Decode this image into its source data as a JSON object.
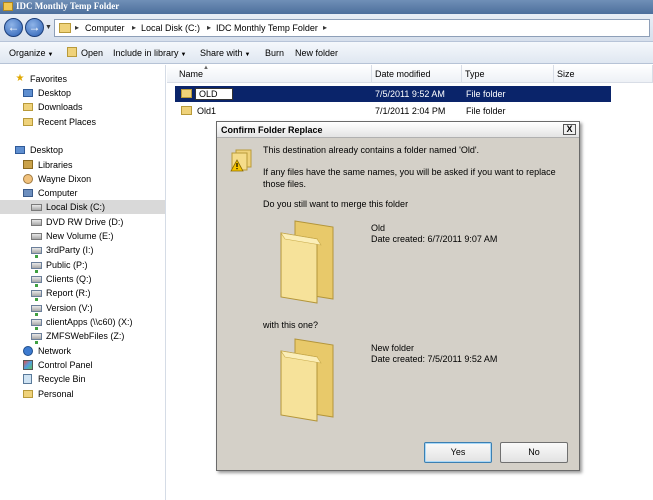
{
  "window": {
    "title": "IDC Monthly Temp Folder"
  },
  "address": {
    "crumbs": [
      "Computer",
      "Local Disk (C:)",
      "IDC Monthly Temp Folder"
    ]
  },
  "toolbar": {
    "organize": "Organize",
    "open": "Open",
    "include_in_library": "Include in library",
    "share_with": "Share with",
    "burn": "Burn",
    "new_folder": "New folder"
  },
  "nav": {
    "favorites": "Favorites",
    "desktop": "Desktop",
    "downloads": "Downloads",
    "recent_places": "Recent Places",
    "desktop_root": "Desktop",
    "libraries": "Libraries",
    "user": "Wayne Dixon",
    "computer": "Computer",
    "drives": [
      "Local Disk (C:)",
      "DVD RW Drive (D:)",
      "New Volume (E:)",
      "3rdParty (I:)",
      "Public (P:)",
      "Clients (Q:)",
      "Report (R:)",
      "Version (V:)",
      "clientApps (\\\\c60) (X:)",
      "ZMFSWebFiles (Z:)"
    ],
    "network": "Network",
    "control_panel": "Control Panel",
    "recycle_bin": "Recycle Bin",
    "personal": "Personal"
  },
  "columns": {
    "name": "Name",
    "date_modified": "Date modified",
    "type": "Type",
    "size": "Size"
  },
  "files": [
    {
      "name": "OLD",
      "date": "7/5/2011 9:52 AM",
      "type": "File folder"
    },
    {
      "name": "Old1",
      "date": "7/1/2011 2:04 PM",
      "type": "File folder"
    }
  ],
  "dialog": {
    "title": "Confirm Folder Replace",
    "message": "This destination already contains a folder named 'Old'.",
    "detail": "If any files have the same names, you will be asked if you want to replace those files.",
    "question": "Do you still want to merge this folder",
    "source_name": "Old",
    "source_date": "Date created: 6/7/2011 9:07 AM",
    "with_text": "with this one?",
    "target_name": "New folder",
    "target_date": "Date created: 7/5/2011 9:52 AM",
    "yes": "Yes",
    "no": "No",
    "close": "X"
  }
}
